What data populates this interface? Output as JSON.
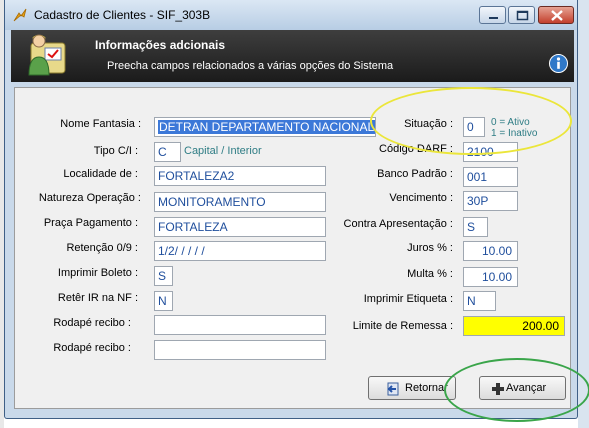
{
  "window": {
    "title": "Cadastro de Clientes - SIF_303B"
  },
  "header": {
    "title": "Informações adcionais",
    "subtitle": "Preecha campos relacionados a várias opções do Sistema"
  },
  "left_fields": {
    "nome_fantasia": {
      "label": "Nome Fantasia :",
      "value": "DETRAN DEPARTAMENTO NACIONAL"
    },
    "tipo_ci": {
      "label": "Tipo C/I :",
      "value": "C",
      "hint": "Capital / Interior"
    },
    "localidade": {
      "label": "Localidade de :",
      "value": "FORTALEZA2"
    },
    "natureza_operacao": {
      "label": "Natureza Operação :",
      "value": "MONITORAMENTO"
    },
    "praca_pagamento": {
      "label": "Praça Pagamento :",
      "value": "FORTALEZA"
    },
    "retencao": {
      "label": "Retenção 0/9 :",
      "value": "1/2/ / / / /"
    },
    "imprimir_boleto": {
      "label": "Imprimir Boleto :",
      "value": "S"
    },
    "reter_ir": {
      "label": "Retêr IR na NF :",
      "value": "N"
    },
    "rodape_recibo_1": {
      "label": "Rodapé recibo :",
      "value": ""
    },
    "rodape_recibo_2": {
      "label": "Rodapé recibo :",
      "value": ""
    }
  },
  "right_fields": {
    "situacao": {
      "label": "Situação :",
      "value": "0",
      "hint_line1": "0 = Ativo",
      "hint_line2": "1 = Inativo"
    },
    "codigo_darf": {
      "label": "Código DARF :",
      "value": "2100"
    },
    "banco_padrao": {
      "label": "Banco Padrão :",
      "value": "001"
    },
    "vencimento": {
      "label": "Vencimento :",
      "value": "30P"
    },
    "contra_apresentacao": {
      "label": "Contra Apresentação :",
      "value": "S"
    },
    "juros": {
      "label": "Juros % :",
      "value": "10.00"
    },
    "multa": {
      "label": "Multa % :",
      "value": "10.00"
    },
    "imprimir_etiqueta": {
      "label": "Imprimir Etiqueta :",
      "value": "N"
    },
    "limite_remessa": {
      "label": "Limite de Remessa :",
      "value": "200.00"
    }
  },
  "buttons": {
    "retornar": "Retornar",
    "avancar": "Avançar"
  },
  "colors": {
    "highlight_yellow": "#ffff00",
    "annotation_yellow": "#ebe63a",
    "annotation_green": "#3aa54a",
    "field_text": "#1f4e9c",
    "hint_text": "#2f7d85"
  }
}
